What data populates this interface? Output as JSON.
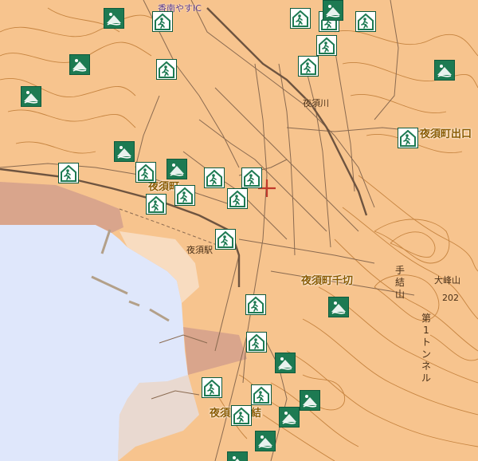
{
  "map": {
    "colors": {
      "land": "#f7c48e",
      "sea": "#dfe7fb",
      "reclaimed": "#d9a58c",
      "contour": "#c68440",
      "road": "#8a6a50",
      "rail": "#6e5440",
      "icon_green": "#1d7a52"
    },
    "labels": {
      "ic": "香南やすIC",
      "yasu_river": "夜須川",
      "yasu_station": "夜須駅",
      "demachi": "夜須町出口",
      "senkiri": "夜須町千切",
      "town_center": "夜須町",
      "tegi": "夜須町手結",
      "peak_name": "大峰山",
      "peak_elev": "202",
      "tei_mountain_vertical": "手結山",
      "tunnel_vertical": "第1トンネル"
    },
    "marker_types": {
      "shelter": "evacuation-shelter-icon (person running into building)",
      "hazard": "hazard-warning-icon (landslide / wave sign)"
    },
    "crosshair": "red-crosshair-icon"
  }
}
